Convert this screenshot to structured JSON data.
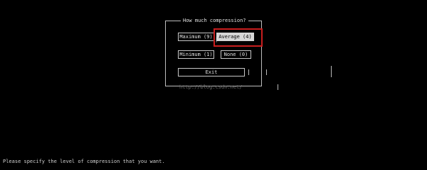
{
  "dialog": {
    "title": "How much compression?",
    "buttons": {
      "maximum": "Maximum (9)",
      "average": "Average (4)",
      "minimum": "Minimum (1)",
      "none": "None (0)",
      "exit": "Exit"
    }
  },
  "watermark": "http://blog.csdn.net/",
  "status": "Please specify the level of compression that you want.",
  "colors": {
    "background": "#000000",
    "text": "#d8d8d8",
    "selected_bg": "#d6d6d6",
    "annotation": "#c81e1e"
  }
}
